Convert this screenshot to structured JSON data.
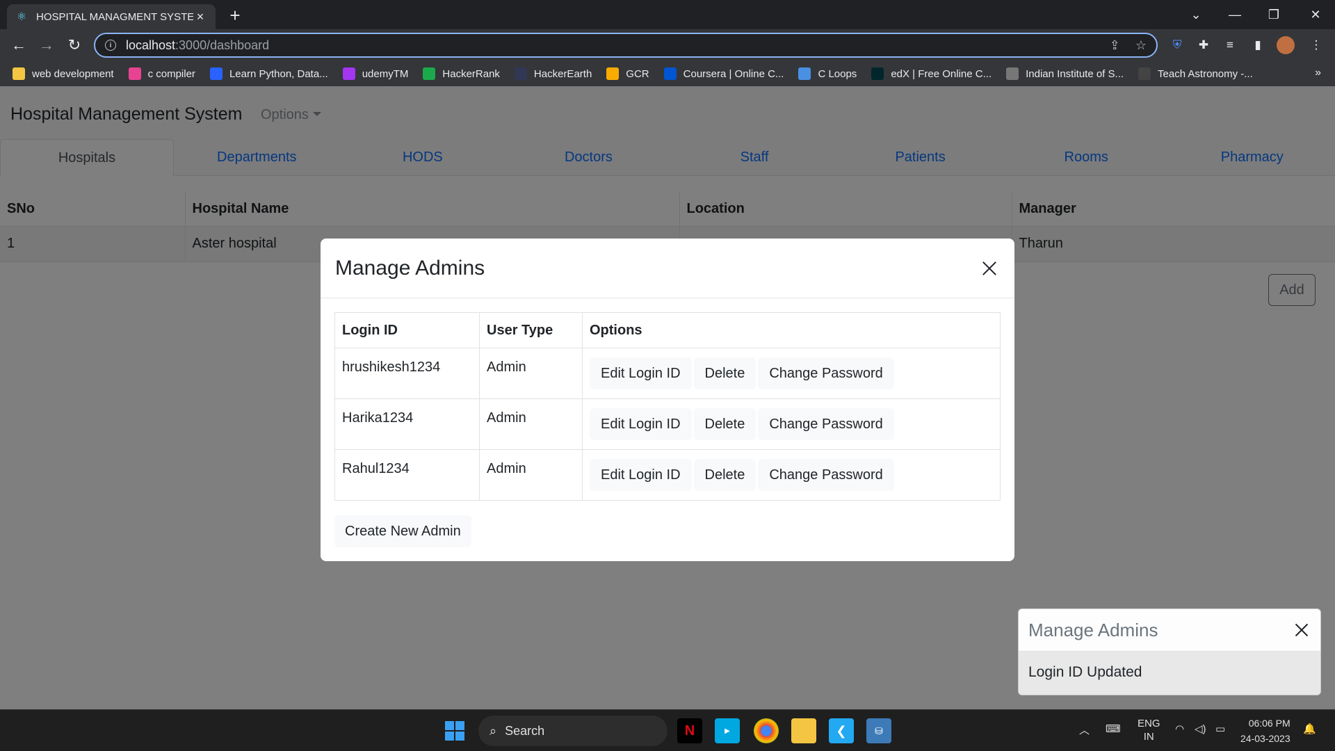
{
  "browser": {
    "tab_title": "HOSPITAL MANAGMENT SYSTEM",
    "url_host": "localhost",
    "url_path": ":3000/dashboard",
    "bookmarks": [
      {
        "label": "web development",
        "icon": "folder-icon",
        "color": "#f4c542"
      },
      {
        "label": "c compiler",
        "icon": "c-compiler-icon",
        "color": "#e84393"
      },
      {
        "label": "Learn Python, Data...",
        "icon": "k-icon",
        "color": "#2962ff"
      },
      {
        "label": "udemyTM",
        "icon": "udemy-icon",
        "color": "#a435f0"
      },
      {
        "label": "HackerRank",
        "icon": "hackerrank-icon",
        "color": "#1ba94c"
      },
      {
        "label": "HackerEarth",
        "icon": "hackerearth-icon",
        "color": "#323754"
      },
      {
        "label": "GCR",
        "icon": "classroom-icon",
        "color": "#f9ab00"
      },
      {
        "label": "Coursera | Online C...",
        "icon": "coursera-icon",
        "color": "#0056d2"
      },
      {
        "label": "C Loops",
        "icon": "diamond-icon",
        "color": "#4a90e2"
      },
      {
        "label": "edX | Free Online C...",
        "icon": "edx-icon",
        "color": "#02262b"
      },
      {
        "label": "Indian Institute of S...",
        "icon": "iisc-icon",
        "color": "#777777"
      },
      {
        "label": "Teach Astronomy -...",
        "icon": "ta-icon",
        "color": "#444444"
      }
    ]
  },
  "app": {
    "brand": "Hospital Management System",
    "options_label": "Options",
    "tabs": [
      {
        "label": "Hospitals",
        "active": true
      },
      {
        "label": "Departments"
      },
      {
        "label": "HODS"
      },
      {
        "label": "Doctors"
      },
      {
        "label": "Staff"
      },
      {
        "label": "Patients"
      },
      {
        "label": "Rooms"
      },
      {
        "label": "Pharmacy"
      }
    ],
    "table": {
      "headers": [
        "SNo",
        "Hospital Name",
        "Location",
        "Manager"
      ],
      "rows": [
        [
          "1",
          "Aster hospital",
          "",
          "Tharun"
        ]
      ]
    },
    "add_label": "Add"
  },
  "modal": {
    "title": "Manage Admins",
    "headers": [
      "Login ID",
      "User Type",
      "Options"
    ],
    "rows": [
      {
        "login_id": "hrushikesh1234",
        "user_type": "Admin"
      },
      {
        "login_id": "Harika1234",
        "user_type": "Admin"
      },
      {
        "login_id": "Rahul1234",
        "user_type": "Admin"
      }
    ],
    "edit_label": "Edit Login ID",
    "delete_label": "Delete",
    "change_pw_label": "Change Password",
    "create_label": "Create New Admin"
  },
  "toast": {
    "title": "Manage Admins",
    "message": "Login ID Updated"
  },
  "taskbar": {
    "search_label": "Search",
    "lang_top": "ENG",
    "lang_bottom": "IN",
    "time": "06:06 PM",
    "date": "24-03-2023"
  }
}
